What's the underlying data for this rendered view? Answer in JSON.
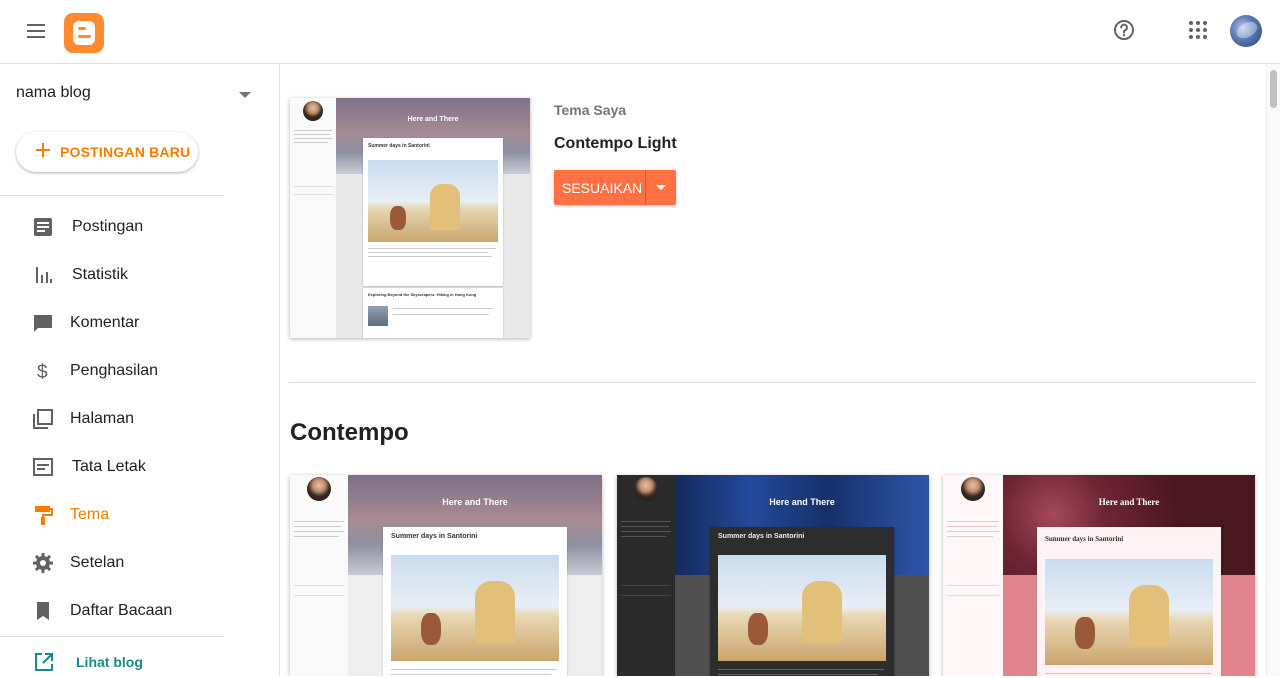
{
  "topbar": {
    "menu_icon": "hamburger-icon",
    "logo": "blogger-logo",
    "help_icon": "help-icon",
    "apps_icon": "apps-grid-icon",
    "avatar_icon": "account-avatar"
  },
  "sidebar": {
    "blog_name": "nama blog",
    "new_post_label": "POSTINGAN BARU",
    "items": [
      {
        "label": "Postingan",
        "icon": "posts-icon",
        "active": false
      },
      {
        "label": "Statistik",
        "icon": "stats-icon",
        "active": false
      },
      {
        "label": "Komentar",
        "icon": "comments-icon",
        "active": false
      },
      {
        "label": "Penghasilan",
        "icon": "dollar-icon",
        "active": false
      },
      {
        "label": "Halaman",
        "icon": "pages-icon",
        "active": false
      },
      {
        "label": "Tata Letak",
        "icon": "layout-icon",
        "active": false
      },
      {
        "label": "Tema",
        "icon": "theme-roller-icon",
        "active": true
      },
      {
        "label": "Setelan",
        "icon": "gear-icon",
        "active": false
      },
      {
        "label": "Daftar Bacaan",
        "icon": "bookmark-icon",
        "active": false
      }
    ],
    "view_blog_label": "Lihat blog"
  },
  "current_theme": {
    "section_label": "Tema Saya",
    "name": "Contempo Light",
    "customize_label": "SESUAIKAN",
    "preview": {
      "blog_title": "Here and There",
      "post_title": "Summer days in Santorini",
      "post2_title": "Exploring Beyond the Skyscrapers: Hiking in Hong Kong"
    }
  },
  "gallery": {
    "section_title": "Contempo",
    "themes": [
      {
        "variant": "light",
        "blog_title": "Here and There",
        "post_title": "Summer days in Santorini"
      },
      {
        "variant": "dark",
        "blog_title": "Here and There",
        "post_title": "Summer days in Santorini"
      },
      {
        "variant": "floral",
        "blog_title": "Here and There",
        "post_title": "Summer days in Santorini"
      }
    ]
  },
  "colors": {
    "accent": "#f57d00",
    "customize_button": "#ff7043",
    "link_teal": "#188a8a"
  }
}
